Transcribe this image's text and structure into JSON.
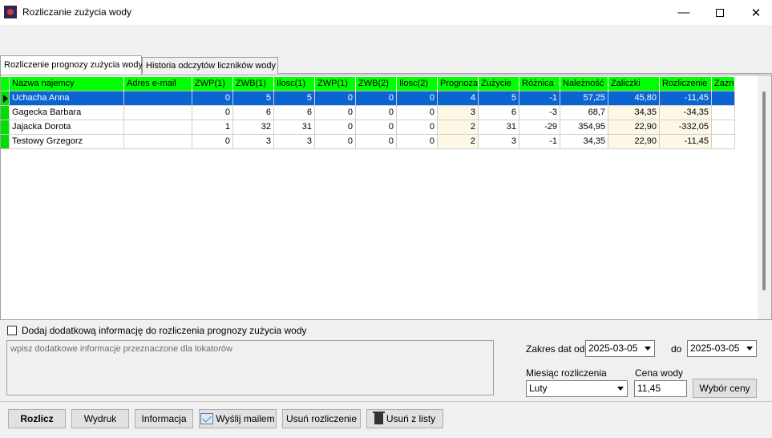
{
  "window": {
    "title": "Rozliczanie zużycia wody",
    "minimize": "—",
    "close": "✕"
  },
  "tabs": [
    {
      "label": "Rozliczenie prognozy zużycia wody",
      "active": true
    },
    {
      "label": "Historia odczytów liczników wody",
      "active": false
    }
  ],
  "grid": {
    "columns": [
      "Nazwa najemcy",
      "Adres e-mail",
      "ZWP(1)",
      "ZWB(1)",
      "Ilosc(1)",
      "ZWP(1)",
      "ZWB(2)",
      "Ilosc(2)",
      "Prognoza",
      "Zużycie",
      "Różnica",
      "Należność",
      "Zaliczki",
      "Rozliczenie",
      "Zazn."
    ],
    "rows": [
      [
        "Uchacha Anna",
        "",
        "0",
        "5",
        "5",
        "0",
        "0",
        "0",
        "4",
        "5",
        "-1",
        "57,25",
        "45,80",
        "-11,45",
        ""
      ],
      [
        "Gagecka Barbara",
        "",
        "0",
        "6",
        "6",
        "0",
        "0",
        "0",
        "3",
        "6",
        "-3",
        "68,7",
        "34,35",
        "-34,35",
        ""
      ],
      [
        "Jajacka Dorota",
        "",
        "1",
        "32",
        "31",
        "0",
        "0",
        "0",
        "2",
        "31",
        "-29",
        "354,95",
        "22,90",
        "-332,05",
        ""
      ],
      [
        "Testowy Grzegorz",
        "",
        "0",
        "3",
        "3",
        "0",
        "0",
        "0",
        "2",
        "3",
        "-1",
        "34,35",
        "22,90",
        "-11,45",
        ""
      ]
    ],
    "selected_row": 0
  },
  "extra_info": {
    "checkbox_label": "Dodaj dodatkową informację do rozliczenia prognozy zużycia wody",
    "placeholder": "wpisz dodatkowe informacje przeznaczone dla lokatorów"
  },
  "date_range": {
    "from_label": "Zakres dat od",
    "from_value": "2025-03-05",
    "to_label": "do",
    "to_value": "2025-03-05"
  },
  "month": {
    "label": "Miesiąc rozliczenia",
    "value": "Luty"
  },
  "price": {
    "label": "Cena wody",
    "value": "11,45",
    "choose_button": "Wybór ceny"
  },
  "buttons": {
    "settle": "Rozlicz",
    "print": "Wydruk",
    "info": "Informacja",
    "send_mail": "Wyślij mailem",
    "remove_settlement": "Usuń rozliczenie",
    "remove_from_list": "Usuń z listy"
  }
}
